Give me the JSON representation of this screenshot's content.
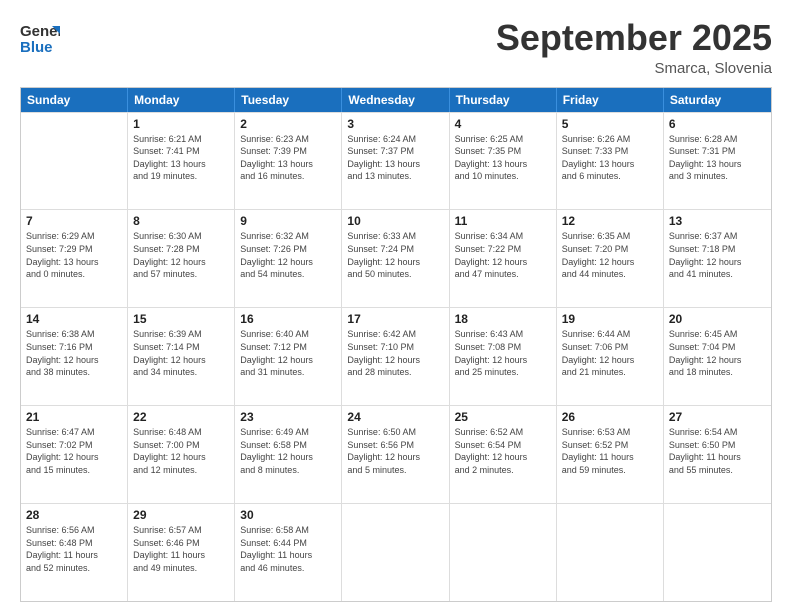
{
  "header": {
    "logo_general": "General",
    "logo_blue": "Blue",
    "month_title": "September 2025",
    "location": "Smarca, Slovenia"
  },
  "weekdays": [
    "Sunday",
    "Monday",
    "Tuesday",
    "Wednesday",
    "Thursday",
    "Friday",
    "Saturday"
  ],
  "rows": [
    [
      {
        "day": "",
        "info": ""
      },
      {
        "day": "1",
        "info": "Sunrise: 6:21 AM\nSunset: 7:41 PM\nDaylight: 13 hours\nand 19 minutes."
      },
      {
        "day": "2",
        "info": "Sunrise: 6:23 AM\nSunset: 7:39 PM\nDaylight: 13 hours\nand 16 minutes."
      },
      {
        "day": "3",
        "info": "Sunrise: 6:24 AM\nSunset: 7:37 PM\nDaylight: 13 hours\nand 13 minutes."
      },
      {
        "day": "4",
        "info": "Sunrise: 6:25 AM\nSunset: 7:35 PM\nDaylight: 13 hours\nand 10 minutes."
      },
      {
        "day": "5",
        "info": "Sunrise: 6:26 AM\nSunset: 7:33 PM\nDaylight: 13 hours\nand 6 minutes."
      },
      {
        "day": "6",
        "info": "Sunrise: 6:28 AM\nSunset: 7:31 PM\nDaylight: 13 hours\nand 3 minutes."
      }
    ],
    [
      {
        "day": "7",
        "info": "Sunrise: 6:29 AM\nSunset: 7:29 PM\nDaylight: 13 hours\nand 0 minutes."
      },
      {
        "day": "8",
        "info": "Sunrise: 6:30 AM\nSunset: 7:28 PM\nDaylight: 12 hours\nand 57 minutes."
      },
      {
        "day": "9",
        "info": "Sunrise: 6:32 AM\nSunset: 7:26 PM\nDaylight: 12 hours\nand 54 minutes."
      },
      {
        "day": "10",
        "info": "Sunrise: 6:33 AM\nSunset: 7:24 PM\nDaylight: 12 hours\nand 50 minutes."
      },
      {
        "day": "11",
        "info": "Sunrise: 6:34 AM\nSunset: 7:22 PM\nDaylight: 12 hours\nand 47 minutes."
      },
      {
        "day": "12",
        "info": "Sunrise: 6:35 AM\nSunset: 7:20 PM\nDaylight: 12 hours\nand 44 minutes."
      },
      {
        "day": "13",
        "info": "Sunrise: 6:37 AM\nSunset: 7:18 PM\nDaylight: 12 hours\nand 41 minutes."
      }
    ],
    [
      {
        "day": "14",
        "info": "Sunrise: 6:38 AM\nSunset: 7:16 PM\nDaylight: 12 hours\nand 38 minutes."
      },
      {
        "day": "15",
        "info": "Sunrise: 6:39 AM\nSunset: 7:14 PM\nDaylight: 12 hours\nand 34 minutes."
      },
      {
        "day": "16",
        "info": "Sunrise: 6:40 AM\nSunset: 7:12 PM\nDaylight: 12 hours\nand 31 minutes."
      },
      {
        "day": "17",
        "info": "Sunrise: 6:42 AM\nSunset: 7:10 PM\nDaylight: 12 hours\nand 28 minutes."
      },
      {
        "day": "18",
        "info": "Sunrise: 6:43 AM\nSunset: 7:08 PM\nDaylight: 12 hours\nand 25 minutes."
      },
      {
        "day": "19",
        "info": "Sunrise: 6:44 AM\nSunset: 7:06 PM\nDaylight: 12 hours\nand 21 minutes."
      },
      {
        "day": "20",
        "info": "Sunrise: 6:45 AM\nSunset: 7:04 PM\nDaylight: 12 hours\nand 18 minutes."
      }
    ],
    [
      {
        "day": "21",
        "info": "Sunrise: 6:47 AM\nSunset: 7:02 PM\nDaylight: 12 hours\nand 15 minutes."
      },
      {
        "day": "22",
        "info": "Sunrise: 6:48 AM\nSunset: 7:00 PM\nDaylight: 12 hours\nand 12 minutes."
      },
      {
        "day": "23",
        "info": "Sunrise: 6:49 AM\nSunset: 6:58 PM\nDaylight: 12 hours\nand 8 minutes."
      },
      {
        "day": "24",
        "info": "Sunrise: 6:50 AM\nSunset: 6:56 PM\nDaylight: 12 hours\nand 5 minutes."
      },
      {
        "day": "25",
        "info": "Sunrise: 6:52 AM\nSunset: 6:54 PM\nDaylight: 12 hours\nand 2 minutes."
      },
      {
        "day": "26",
        "info": "Sunrise: 6:53 AM\nSunset: 6:52 PM\nDaylight: 11 hours\nand 59 minutes."
      },
      {
        "day": "27",
        "info": "Sunrise: 6:54 AM\nSunset: 6:50 PM\nDaylight: 11 hours\nand 55 minutes."
      }
    ],
    [
      {
        "day": "28",
        "info": "Sunrise: 6:56 AM\nSunset: 6:48 PM\nDaylight: 11 hours\nand 52 minutes."
      },
      {
        "day": "29",
        "info": "Sunrise: 6:57 AM\nSunset: 6:46 PM\nDaylight: 11 hours\nand 49 minutes."
      },
      {
        "day": "30",
        "info": "Sunrise: 6:58 AM\nSunset: 6:44 PM\nDaylight: 11 hours\nand 46 minutes."
      },
      {
        "day": "",
        "info": ""
      },
      {
        "day": "",
        "info": ""
      },
      {
        "day": "",
        "info": ""
      },
      {
        "day": "",
        "info": ""
      }
    ]
  ]
}
